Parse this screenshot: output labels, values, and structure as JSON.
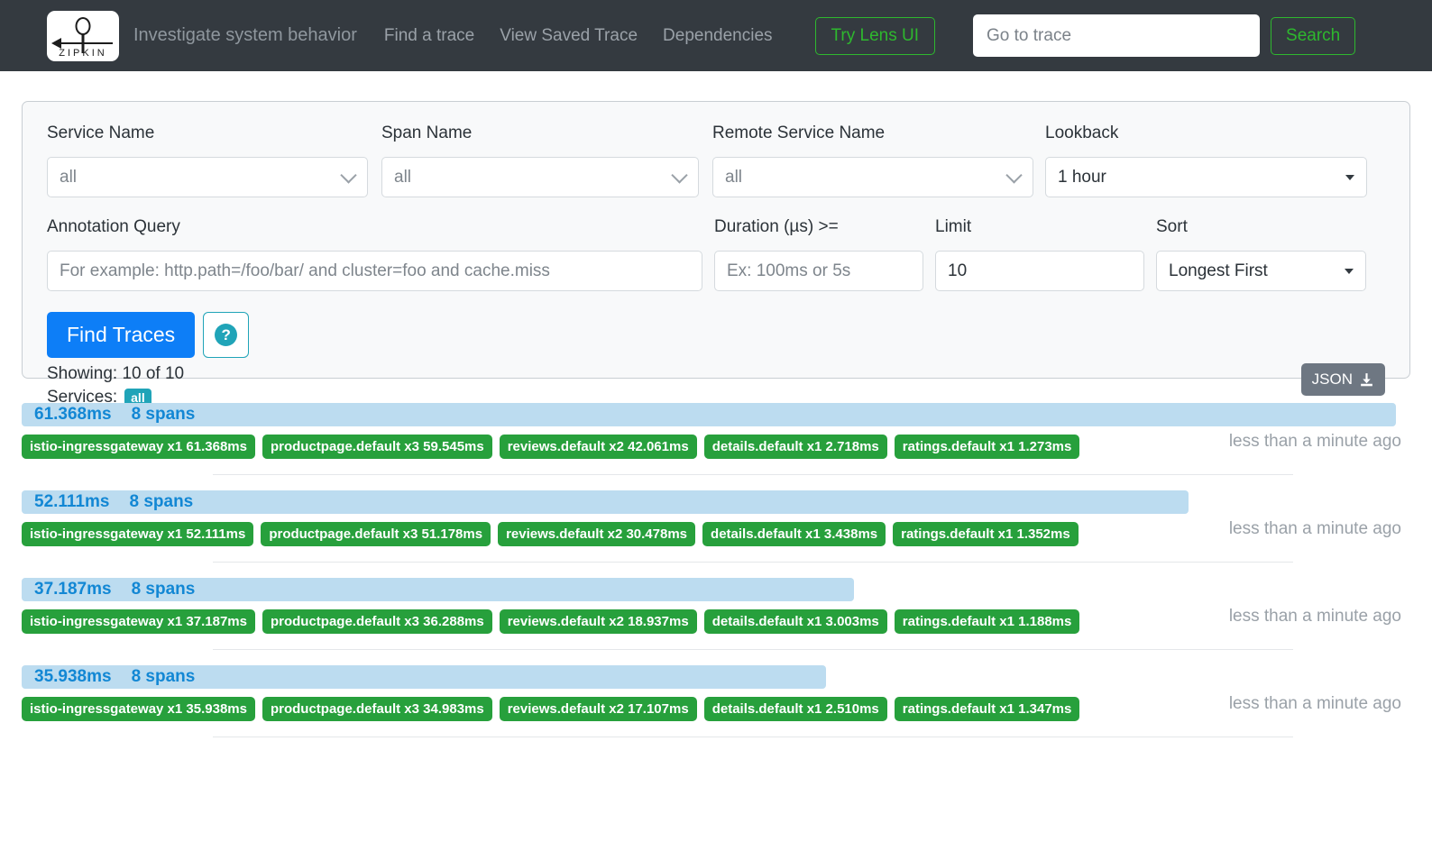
{
  "header": {
    "logo_alt": "ZIPKIN",
    "logo_word": "ZIPKIN",
    "tagline": "Investigate system behavior",
    "nav": [
      {
        "label": "Find a trace"
      },
      {
        "label": "View Saved Trace"
      },
      {
        "label": "Dependencies"
      }
    ],
    "lens_button": "Try Lens UI",
    "trace_input_placeholder": "Go to trace",
    "trace_input_value": "",
    "search_button": "Search",
    "background_color": "#343a40",
    "accent_green": "#2eb82e"
  },
  "search_form": {
    "service_name": {
      "label": "Service Name",
      "value": "all"
    },
    "span_name": {
      "label": "Span Name",
      "value": "all"
    },
    "remote_service_name": {
      "label": "Remote Service Name",
      "value": "all"
    },
    "lookback": {
      "label": "Lookback",
      "value": "1 hour"
    },
    "annotation_query": {
      "label": "Annotation Query",
      "value": "",
      "placeholder": "For example: http.path=/foo/bar/ and cluster=foo and cache.miss"
    },
    "duration": {
      "label": "Duration (µs) >=",
      "value": "",
      "placeholder": "Ex: 100ms or 5s"
    },
    "limit": {
      "label": "Limit",
      "value": "10"
    },
    "sort": {
      "label": "Sort",
      "value": "Longest First"
    },
    "find_traces_button": "Find Traces",
    "help_icon_label": "?",
    "showing_text": "Showing: 10 of 10",
    "services_label": "Services:",
    "services_value": "all",
    "json_button": "JSON",
    "primary_color": "#0d7ef7",
    "teal_color": "#20a4b8"
  },
  "results": {
    "bar_color": "#bcdcf0",
    "bar_text_color": "#1287d4",
    "badge_color": "#27a03c",
    "max_duration_ms": 61.368,
    "traces": [
      {
        "duration": "61.368ms",
        "duration_ms": 61.368,
        "spans": "8 spans",
        "timeago": "less than a minute ago",
        "services": [
          "istio-ingressgateway x1 61.368ms",
          "productpage.default x3 59.545ms",
          "reviews.default x2 42.061ms",
          "details.default x1 2.718ms",
          "ratings.default x1 1.273ms"
        ]
      },
      {
        "duration": "52.111ms",
        "duration_ms": 52.111,
        "spans": "8 spans",
        "timeago": "less than a minute ago",
        "services": [
          "istio-ingressgateway x1 52.111ms",
          "productpage.default x3 51.178ms",
          "reviews.default x2 30.478ms",
          "details.default x1 3.438ms",
          "ratings.default x1 1.352ms"
        ]
      },
      {
        "duration": "37.187ms",
        "duration_ms": 37.187,
        "spans": "8 spans",
        "timeago": "less than a minute ago",
        "services": [
          "istio-ingressgateway x1 37.187ms",
          "productpage.default x3 36.288ms",
          "reviews.default x2 18.937ms",
          "details.default x1 3.003ms",
          "ratings.default x1 1.188ms"
        ]
      },
      {
        "duration": "35.938ms",
        "duration_ms": 35.938,
        "spans": "8 spans",
        "timeago": "less than a minute ago",
        "services": [
          "istio-ingressgateway x1 35.938ms",
          "productpage.default x3 34.983ms",
          "reviews.default x2 17.107ms",
          "details.default x1 2.510ms",
          "ratings.default x1 1.347ms"
        ]
      }
    ]
  }
}
